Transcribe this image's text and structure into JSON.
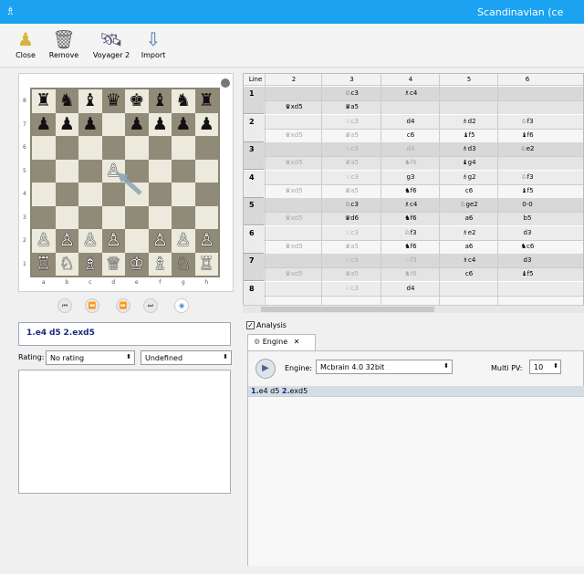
{
  "window": {
    "title": "Scandinavian (ce",
    "app_icon": "chess-app-icon"
  },
  "toolbar": {
    "close": {
      "label": "Close",
      "icon": "pawn-icon"
    },
    "remove": {
      "label": "Remove",
      "icon": "trash-icon"
    },
    "voyager": {
      "label": "Voyager 2",
      "icon": "voyager-icon"
    },
    "import": {
      "label": "Import",
      "icon": "import-icon"
    }
  },
  "board": {
    "files": [
      "a",
      "b",
      "c",
      "d",
      "e",
      "f",
      "g",
      "h"
    ],
    "ranks": [
      "8",
      "7",
      "6",
      "5",
      "4",
      "3",
      "2",
      "1"
    ],
    "pieces": [
      [
        "♜",
        "♞",
        "♝",
        "♛",
        "♚",
        "♝",
        "♞",
        "♜"
      ],
      [
        "♟",
        "♟",
        "♟",
        "",
        "♟",
        "♟",
        "♟",
        "♟"
      ],
      [
        "",
        "",
        "",
        "",
        "",
        "",
        "",
        ""
      ],
      [
        "",
        "",
        "",
        "♙",
        "",
        "",
        "",
        ""
      ],
      [
        "",
        "",
        "",
        "",
        "",
        "",
        "",
        ""
      ],
      [
        "",
        "",
        "",
        "",
        "",
        "",
        "",
        ""
      ],
      [
        "♙",
        "♙",
        "♙",
        "♙",
        "",
        "♙",
        "♙",
        "♙"
      ],
      [
        "♖",
        "♘",
        "♗",
        "♕",
        "♔",
        "♗",
        "♘",
        "♖"
      ]
    ],
    "colors": [
      [
        "b",
        "b",
        "b",
        "b",
        "b",
        "b",
        "b",
        "b"
      ],
      [
        "b",
        "b",
        "b",
        "",
        "b",
        "b",
        "b",
        "b"
      ],
      [
        "",
        "",
        "",
        "",
        "",
        "",
        "",
        ""
      ],
      [
        "",
        "",
        "",
        "w",
        "",
        "",
        "",
        ""
      ],
      [
        "",
        "",
        "",
        "",
        "",
        "",
        "",
        ""
      ],
      [
        "",
        "",
        "",
        "",
        "",
        "",
        "",
        ""
      ],
      [
        "w",
        "w",
        "w",
        "w",
        "",
        "w",
        "w",
        "w"
      ],
      [
        "w",
        "w",
        "w",
        "w",
        "w",
        "w",
        "w",
        "w"
      ]
    ]
  },
  "nav": {
    "first": "⏮",
    "prev": "⏪",
    "next": "⏩",
    "last": "⏭"
  },
  "moves": {
    "n1": "1.",
    "m1": "e4",
    "m2": "d5",
    "n2": "2.",
    "m3": "exd5"
  },
  "rating": {
    "label": "Rating:",
    "value": "No rating",
    "second": "Undefined"
  },
  "grid": {
    "headers": [
      "Line",
      "2",
      "3",
      "4",
      "5",
      "6"
    ],
    "rows": [
      {
        "num": "1",
        "top": [
          "",
          "♘c3",
          "♗c4",
          "",
          ""
        ],
        "bot": [
          "♛xd5",
          "♛a5",
          "",
          "",
          ""
        ],
        "ghost": [
          false,
          false,
          false,
          false,
          false
        ]
      },
      {
        "num": "2",
        "top": [
          "",
          "♘c3",
          "d4",
          "♗d2",
          "♘f3"
        ],
        "bot": [
          "♛xd5",
          "♛a5",
          "c6",
          "♝f5",
          "♝f6"
        ],
        "ghost": [
          true,
          true,
          false,
          false,
          false
        ]
      },
      {
        "num": "3",
        "top": [
          "",
          "♘c3",
          "d4",
          "♗d3",
          "♘e2"
        ],
        "bot": [
          "♛xd5",
          "♛a5",
          "♞f6",
          "♝g4",
          ""
        ],
        "ghost": [
          true,
          true,
          true,
          false,
          false
        ]
      },
      {
        "num": "4",
        "top": [
          "",
          "♘c3",
          "g3",
          "♗g2",
          "♘f3"
        ],
        "bot": [
          "♛xd5",
          "♛a5",
          "♞f6",
          "c6",
          "♝f5"
        ],
        "ghost": [
          true,
          true,
          false,
          false,
          false
        ]
      },
      {
        "num": "5",
        "top": [
          "",
          "♘c3",
          "♗c4",
          "♘ge2",
          "0-0"
        ],
        "bot": [
          "♛xd5",
          "♛d6",
          "♞f6",
          "a6",
          "b5"
        ],
        "ghost": [
          true,
          false,
          false,
          false,
          false
        ]
      },
      {
        "num": "6",
        "top": [
          "",
          "♘c3",
          "♘f3",
          "♗e2",
          "d3"
        ],
        "bot": [
          "♛xd5",
          "♛a5",
          "♞f6",
          "a6",
          "♞c6"
        ],
        "ghost": [
          true,
          true,
          false,
          false,
          false
        ]
      },
      {
        "num": "7",
        "top": [
          "",
          "♘c3",
          "♘f3",
          "♗c4",
          "d3"
        ],
        "bot": [
          "♛xd5",
          "♛a5",
          "♞f6",
          "c6",
          "♝f5"
        ],
        "ghost": [
          true,
          true,
          true,
          false,
          false
        ]
      },
      {
        "num": "8",
        "top": [
          "",
          "♘c3",
          "d4",
          "",
          ""
        ],
        "bot": [
          "",
          "",
          "",
          "",
          ""
        ],
        "ghost": [
          true,
          true,
          false,
          false,
          false
        ]
      }
    ]
  },
  "analysis": {
    "checkbox_label": "Analysis",
    "tab_label": "Engine",
    "engine_label": "Engine:",
    "engine_value": "Mcbrain 4.0 32bit",
    "multipv_label": "Multi PV:",
    "multipv_value": "10",
    "pv": {
      "n1": "1.",
      "m1": "e4 d5",
      "n2": "2.",
      "m2": "exd5"
    }
  }
}
